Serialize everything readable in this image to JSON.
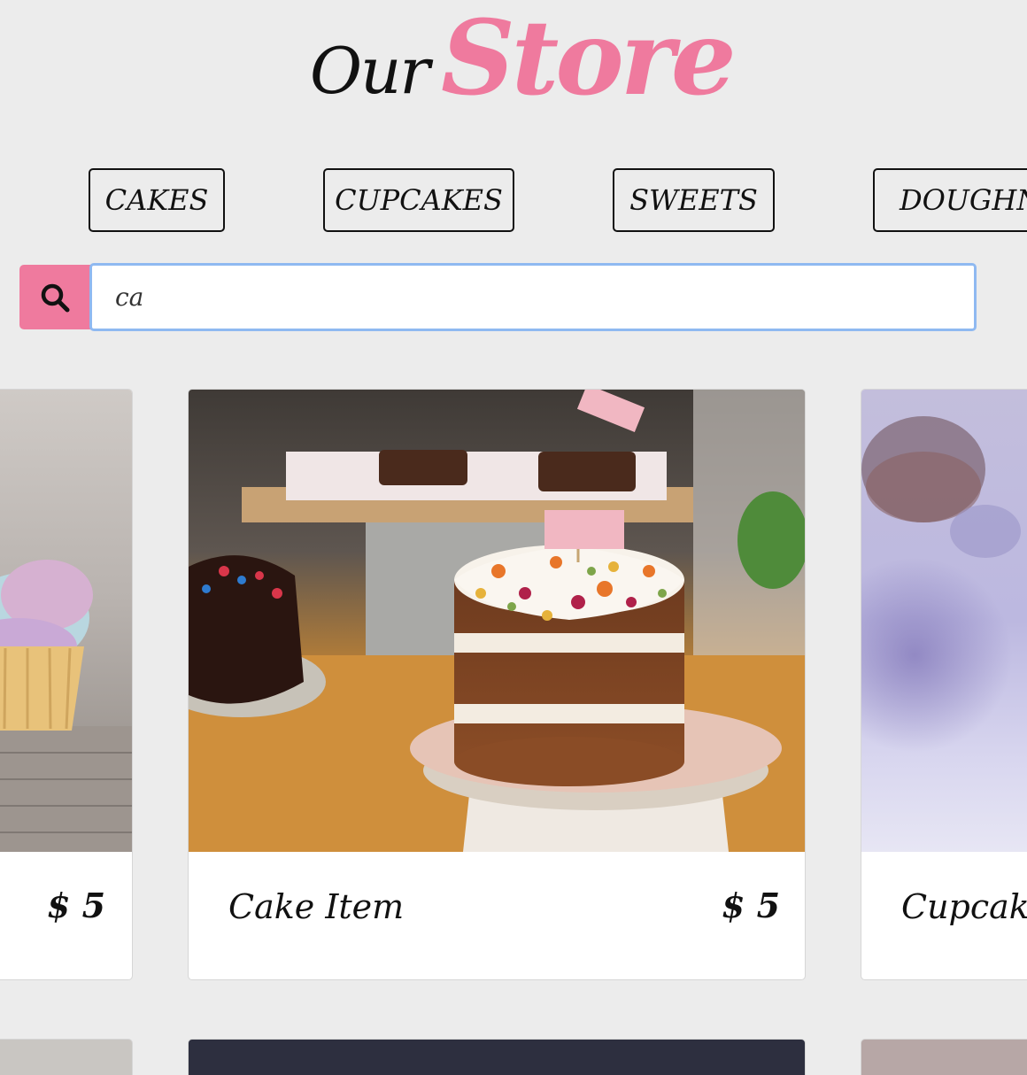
{
  "header": {
    "title_our": "Our",
    "title_store": "Store"
  },
  "categories": [
    {
      "label": "CAKES"
    },
    {
      "label": "CUPCAKES"
    },
    {
      "label": "SWEETS"
    },
    {
      "label": "DOUGHNUTS"
    }
  ],
  "search": {
    "value": "ca",
    "placeholder": ""
  },
  "products": [
    {
      "name": "",
      "price": "$ 5"
    },
    {
      "name": "Cake Item",
      "price": "$ 5"
    },
    {
      "name": "Cupcake",
      "price": ""
    }
  ],
  "colors": {
    "accent": "#ef7a9e",
    "background": "#ececec",
    "focus_ring": "#8fb9f1"
  }
}
